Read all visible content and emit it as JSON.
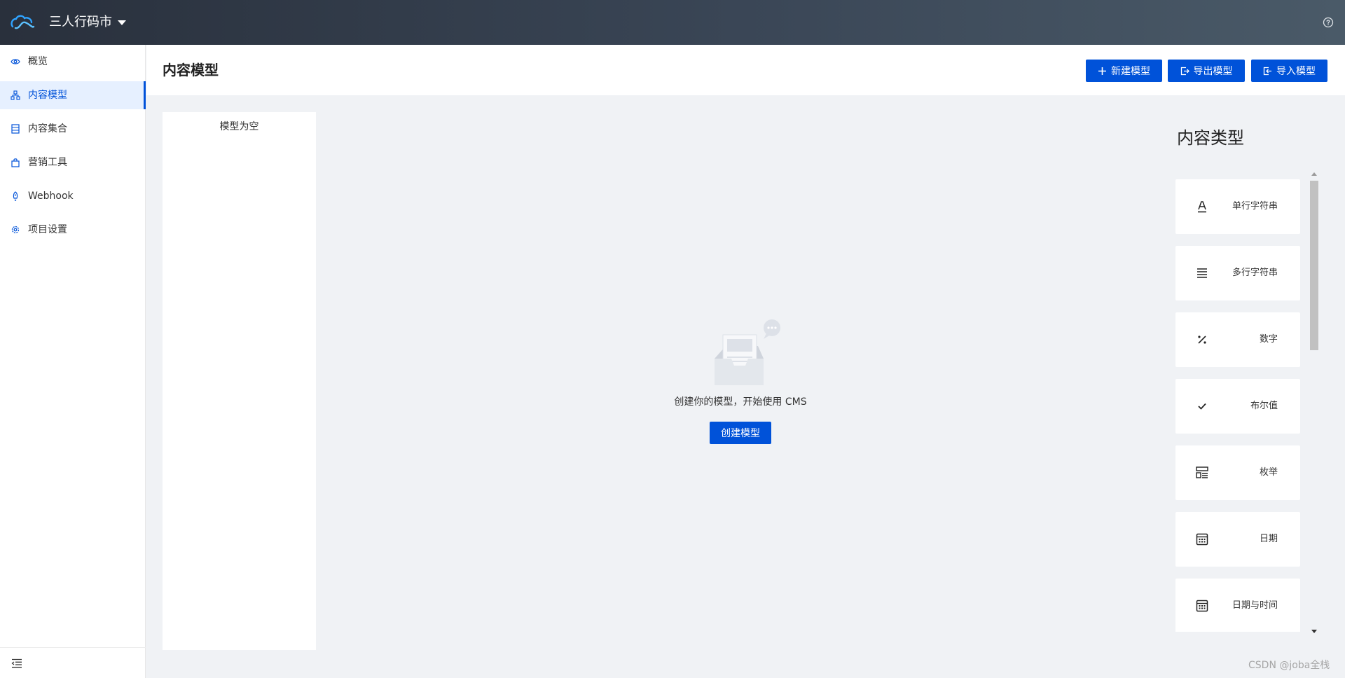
{
  "topbar": {
    "project_name": "三人行码市",
    "logo_icon": "cloudbase-logo-icon",
    "help_icon": "help-circle-icon"
  },
  "sidebar": {
    "items": [
      {
        "label": "概览",
        "icon": "eye-icon"
      },
      {
        "label": "内容模型",
        "icon": "model-tree-icon",
        "active": true
      },
      {
        "label": "内容集合",
        "icon": "list-icon"
      },
      {
        "label": "营销工具",
        "icon": "bag-icon"
      },
      {
        "label": "Webhook",
        "icon": "rocket-icon"
      },
      {
        "label": "项目设置",
        "icon": "gear-icon"
      }
    ],
    "collapse_icon": "collapse-menu-icon"
  },
  "header": {
    "title": "内容模型",
    "buttons": {
      "new_model": "新建模型",
      "export_model": "导出模型",
      "import_model": "导入模型"
    }
  },
  "model_list": {
    "empty_text": "模型为空"
  },
  "empty_state": {
    "message": "创建你的模型，开始使用 CMS",
    "create_button": "创建模型"
  },
  "content_types": {
    "title": "内容类型",
    "items": [
      {
        "label": "单行字符串",
        "icon": "single-line-text-icon"
      },
      {
        "label": "多行字符串",
        "icon": "multi-line-text-icon"
      },
      {
        "label": "数字",
        "icon": "percent-number-icon"
      },
      {
        "label": "布尔值",
        "icon": "check-icon"
      },
      {
        "label": "枚举",
        "icon": "enum-icon"
      },
      {
        "label": "日期",
        "icon": "calendar-icon"
      },
      {
        "label": "日期与时间",
        "icon": "calendar-time-icon"
      }
    ]
  },
  "watermark": "CSDN @joba全栈",
  "colors": {
    "primary": "#0052d9",
    "active_bg": "#e6f0ff",
    "page_bg": "#f0f2f5"
  }
}
